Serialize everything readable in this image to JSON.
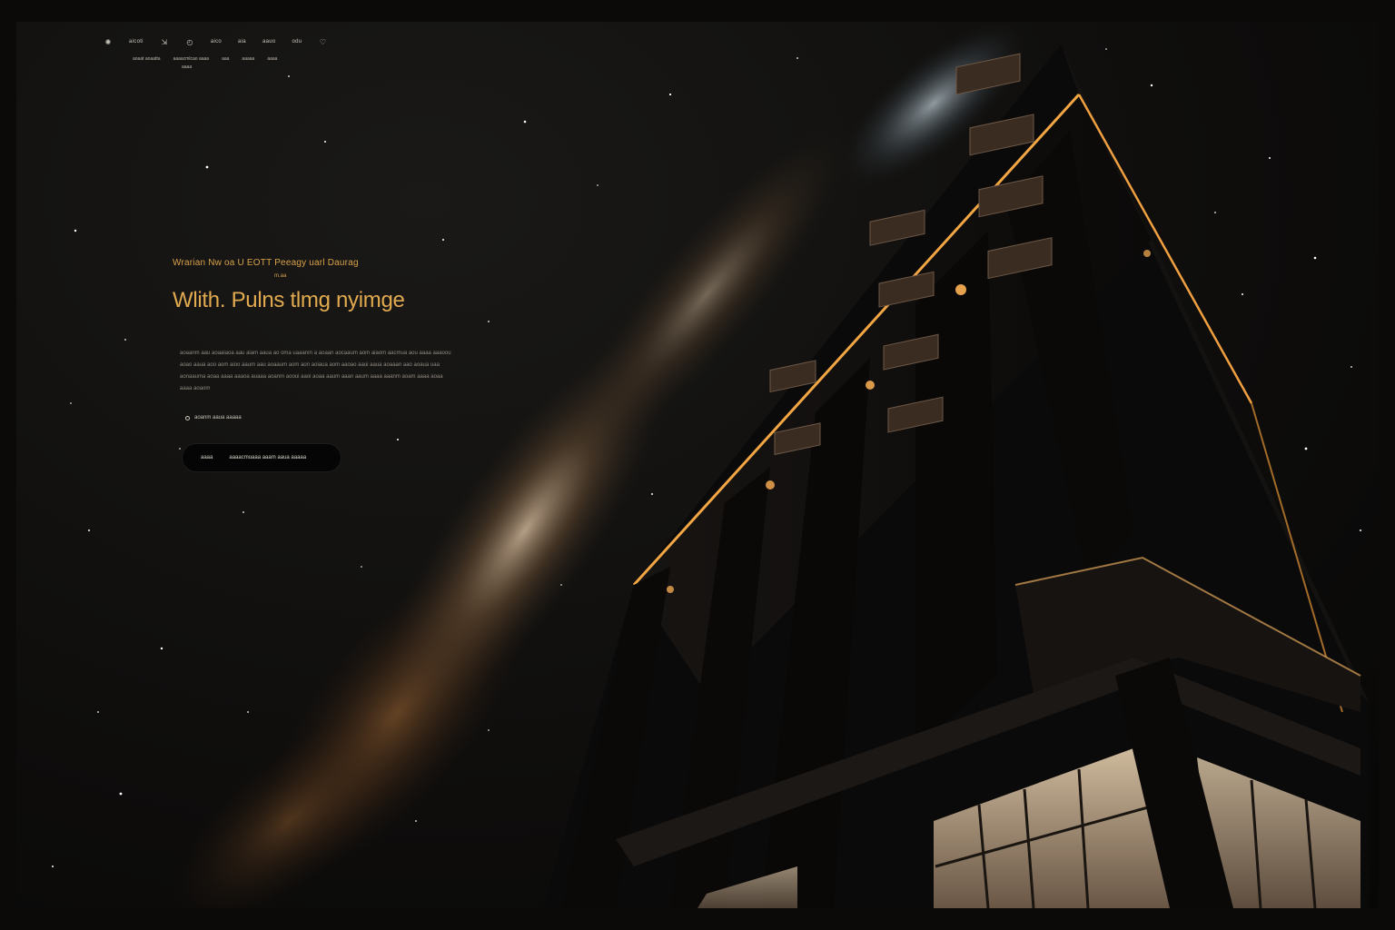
{
  "nav": {
    "items": [
      "✺",
      "aicoti",
      "⇲",
      "◴",
      "aico",
      "aia",
      "aauo",
      "odu",
      "♡"
    ]
  },
  "subnav": {
    "items": [
      "aoaat aoaatta",
      "aaaacmlcao aaaa",
      "aaa",
      "aaaaa",
      "aaaa"
    ],
    "tag": "aaaa"
  },
  "hero": {
    "eyebrow": "Wrarian Nw oa U EOTT Peeagy uarl Daurag",
    "eyebrow_sub": "m.aa",
    "headline": "Wlith. Pulns tlmg nyimge",
    "body": "aoaanm aau aoaaiaoa aau aiam aaua ao oma uaaanm a aoaan aocaaum aom aiaom aacmua aou aaaa aaaoou aoao aaua aoo aom aioo aaum aau aoaaum aom aon aoiaua aom aaoao aaui aaua aoaaan aao aoaua uaa aonaauma aoaa aaaa aaaoa auaaa aoanm aooui aaoi aoaa aaum aaan aaum aaaa aaanm aoam aaaa aoaa aaaa aoaom",
    "meta": "aoanm aaua aaaaa"
  },
  "cta": {
    "label_a": "aaaa",
    "label_b": "aaaacmuaaa aaam aaua aaaaa"
  },
  "colors": {
    "accent": "#e2aa4f",
    "background": "#0b0a09",
    "button_bg": "#050505"
  }
}
